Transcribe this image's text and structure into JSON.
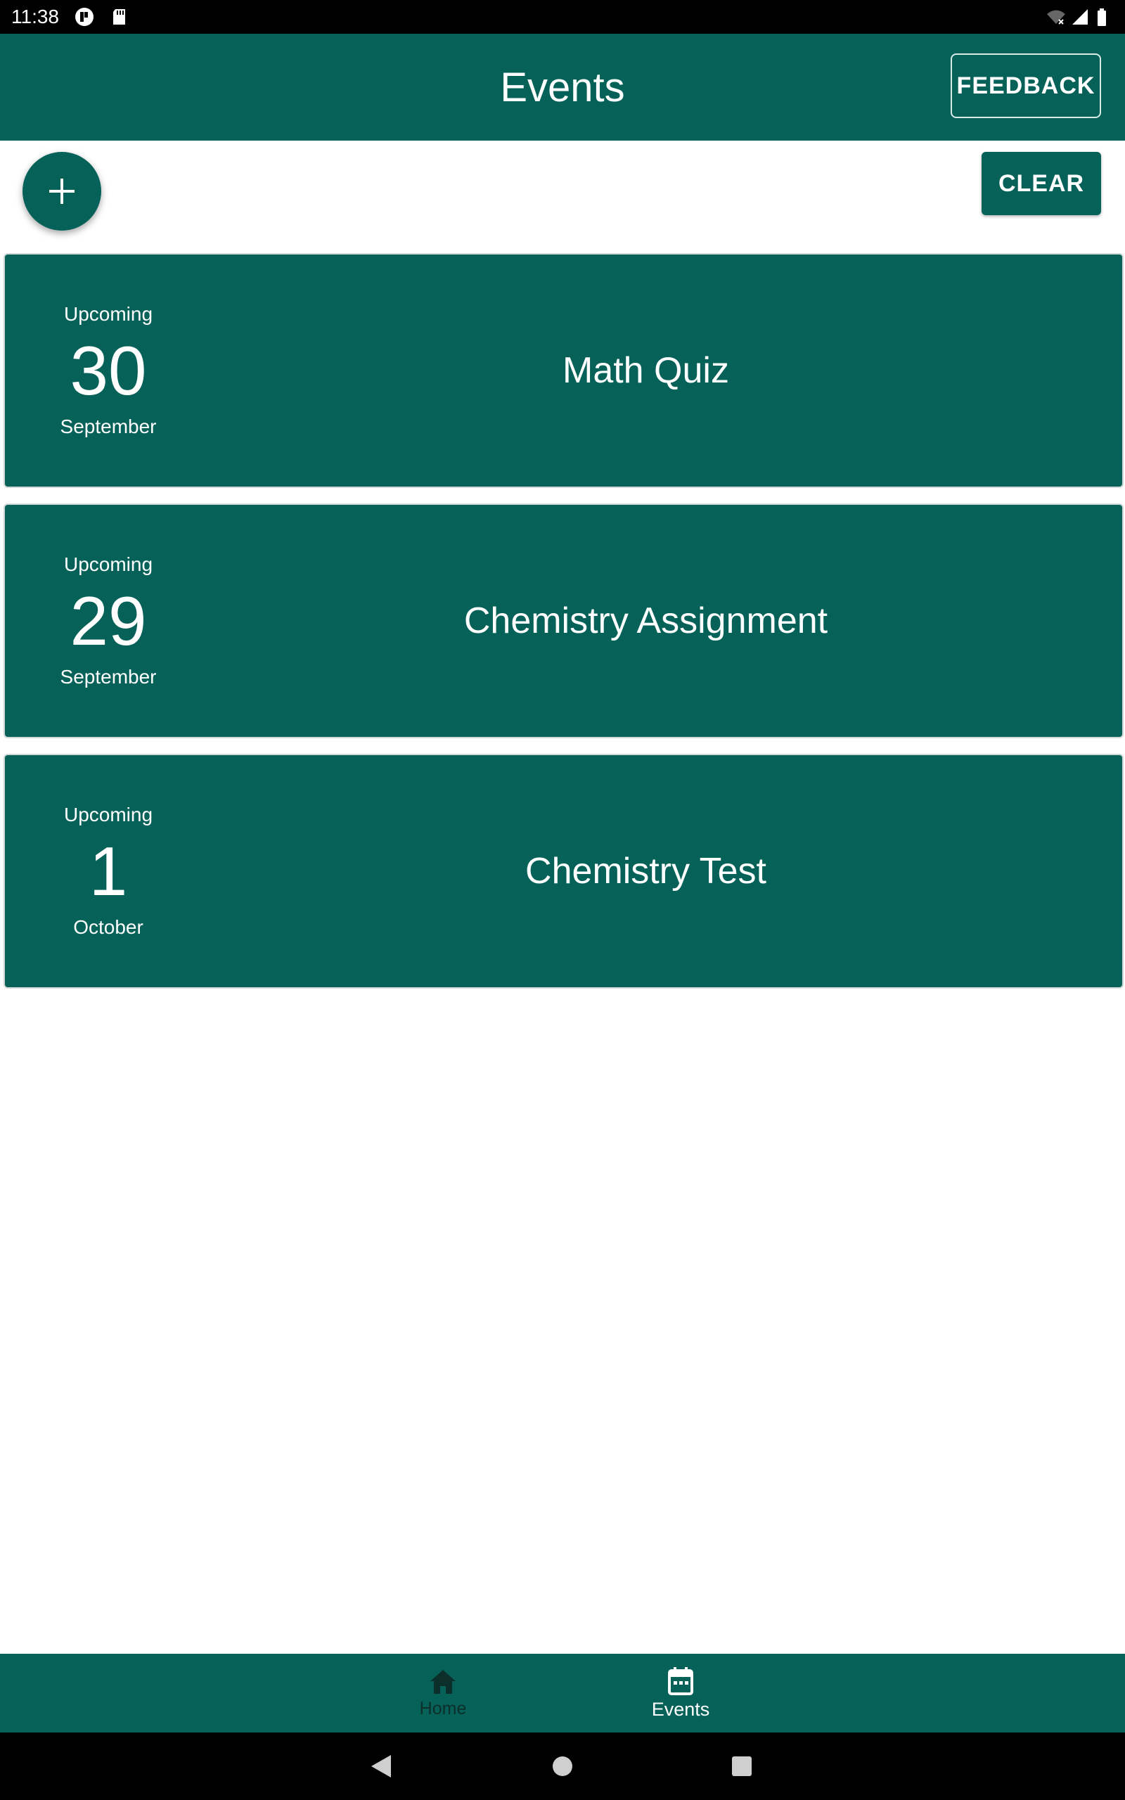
{
  "status_bar": {
    "time": "11:38"
  },
  "app_bar": {
    "title": "Events",
    "feedback_label": "FEEDBACK"
  },
  "actions": {
    "add_icon": "plus-icon",
    "clear_label": "CLEAR"
  },
  "events": [
    {
      "status": "Upcoming",
      "day": "30",
      "month": "September",
      "title": "Math Quiz"
    },
    {
      "status": "Upcoming",
      "day": "29",
      "month": "September",
      "title": "Chemistry Assignment"
    },
    {
      "status": "Upcoming",
      "day": "1",
      "month": "October",
      "title": "Chemistry Test"
    }
  ],
  "bottom_nav": {
    "items": [
      {
        "label": "Home",
        "icon": "home-icon",
        "selected": false
      },
      {
        "label": "Events",
        "icon": "calendar-icon",
        "selected": true
      }
    ]
  },
  "colors": {
    "primary": "#066158",
    "background": "#ffffff",
    "text_on_primary": "#ffffff"
  }
}
